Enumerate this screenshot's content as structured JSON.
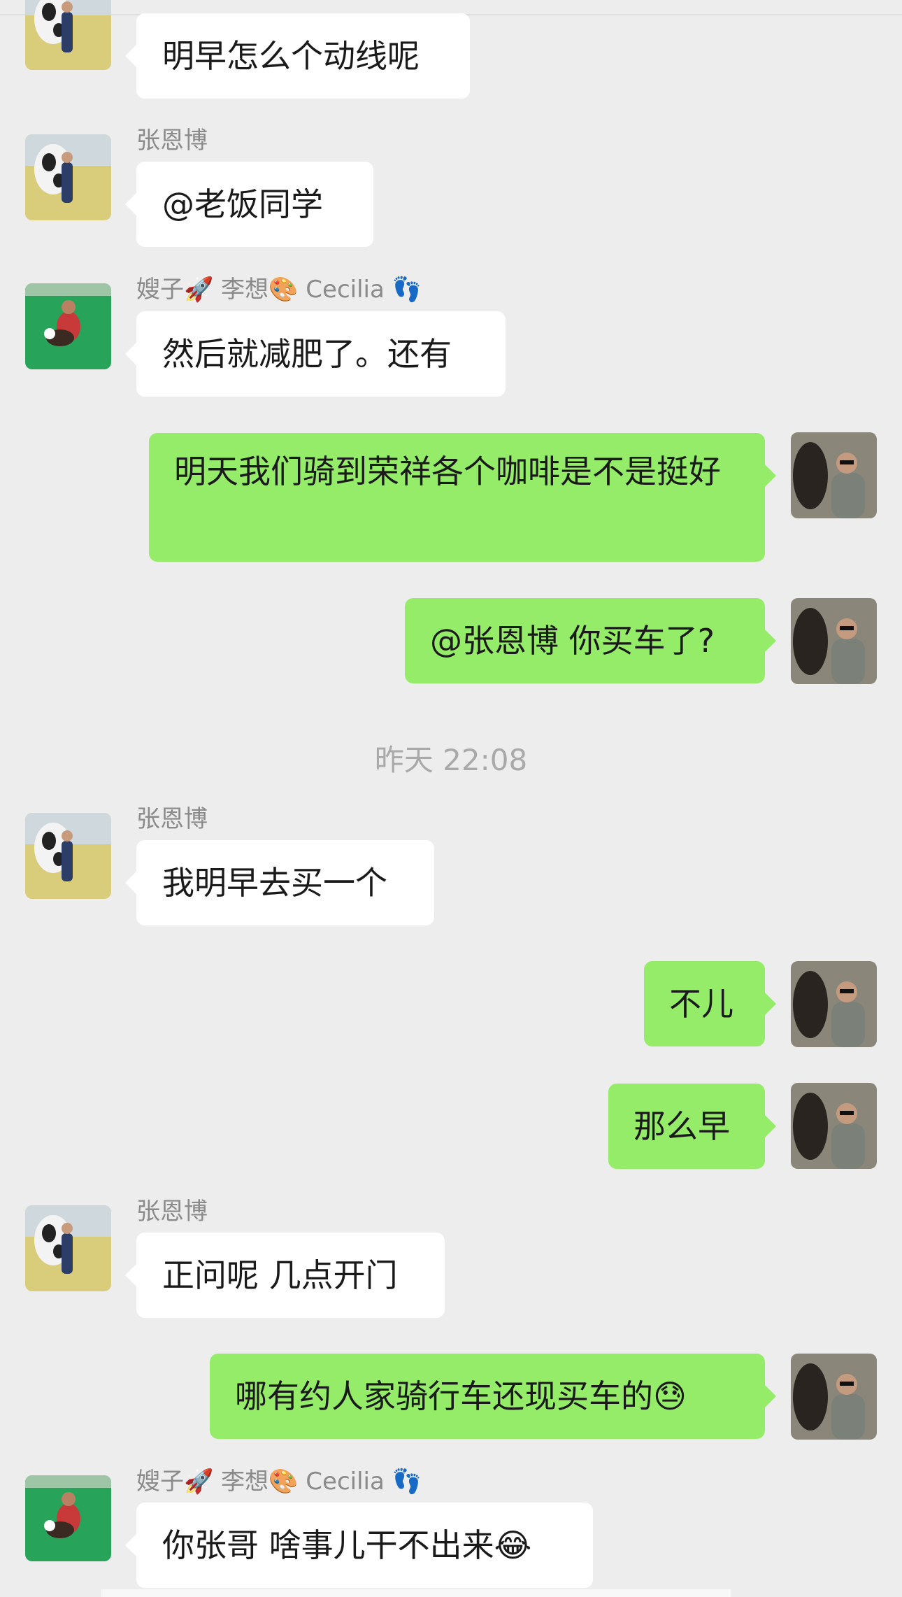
{
  "colors": {
    "background": "#ededed",
    "incoming_bubble": "#ffffff",
    "outgoing_bubble": "#95ec69",
    "sender_name": "#8a8a8a",
    "timestamp": "#a9a9a9"
  },
  "messages": [
    {
      "sender": "",
      "text": "明早怎么个动线呢"
    },
    {
      "sender": "张恩博",
      "text": "@老饭同学"
    },
    {
      "sender": "嫂子🚀 李想🎨 Cecilia 👣",
      "text": "然后就减肥了。还有"
    },
    {
      "sender": "me",
      "text": "明天我们骑到荣祥各个咖啡是不是挺好"
    },
    {
      "sender": "me",
      "text": "@张恩博 你买车了?"
    },
    {
      "sender": "张恩博",
      "text": "我明早去买一个"
    },
    {
      "sender": "me",
      "text": "不儿"
    },
    {
      "sender": "me",
      "text": "那么早"
    },
    {
      "sender": "张恩博",
      "text": "正问呢 几点开门"
    },
    {
      "sender": "me",
      "text": "哪有约人家骑行车还现买车的😓"
    },
    {
      "sender": "嫂子🚀 李想🎨 Cecilia 👣",
      "text": "你张哥 啥事儿干不出来😂"
    }
  ],
  "timestamp": "昨天 22:08",
  "avatars": {
    "zhang_enbo": "person-with-cow-avatar",
    "sister_in_law_group": "person-with-dog-in-pool-avatar",
    "me": "person-with-horse-avatar"
  }
}
